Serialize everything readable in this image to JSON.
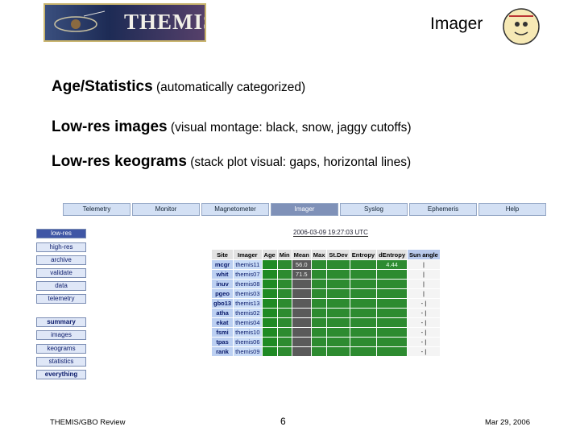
{
  "header": {
    "logo_text": "THEMIS",
    "title": "Imager"
  },
  "bullets": [
    {
      "bold": "Age/Statistics",
      "rest": " (automatically categorized)"
    },
    {
      "bold": "Low-res images",
      "rest": " (visual montage: black, snow, jaggy cutoffs)"
    },
    {
      "bold": "Low-res keograms",
      "rest": " (stack plot visual: gaps, horizontal lines)"
    }
  ],
  "nav": {
    "tabs": [
      "Telemetry",
      "Monitor",
      "Magnetometer",
      "Imager",
      "Syslog",
      "Ephemeris",
      "Help"
    ],
    "active": "Imager"
  },
  "sidebar": [
    "low-res",
    "high-res",
    "archive",
    "validate",
    "data",
    "telemetry",
    "summary",
    "images",
    "keograms",
    "statistics",
    "everything"
  ],
  "datetime": "2006-03-09 19:27:03 UTC",
  "table": {
    "headers": [
      "Site",
      "Imager",
      "Age",
      "Min",
      "Mean",
      "Max",
      "St.Dev",
      "Entropy",
      "dEntropy",
      "Sun angle"
    ],
    "rows": [
      {
        "site": "mcgr",
        "imager": "themis11",
        "min": "",
        "mean": "56.0",
        "max": "",
        "stdev": "",
        "entropy": "",
        "dentropy": "4.44",
        "sun": "|"
      },
      {
        "site": "whit",
        "imager": "themis07",
        "min": "",
        "mean": "71.5",
        "max": "",
        "stdev": "",
        "entropy": "",
        "dentropy": "",
        "sun": "|"
      },
      {
        "site": "inuv",
        "imager": "themis08",
        "min": "",
        "mean": "",
        "max": "",
        "stdev": "",
        "entropy": "",
        "dentropy": "",
        "sun": "|"
      },
      {
        "site": "pgeo",
        "imager": "themis03",
        "min": "",
        "mean": "",
        "max": "",
        "stdev": "",
        "entropy": "",
        "dentropy": "",
        "sun": "|"
      },
      {
        "site": "gbo13",
        "imager": "themis13",
        "min": "",
        "mean": "",
        "max": "",
        "stdev": "",
        "entropy": "",
        "dentropy": "",
        "sun": "- |"
      },
      {
        "site": "atha",
        "imager": "themis02",
        "min": "",
        "mean": "",
        "max": "",
        "stdev": "",
        "entropy": "",
        "dentropy": "",
        "sun": "- |"
      },
      {
        "site": "ekat",
        "imager": "themis04",
        "min": "",
        "mean": "",
        "max": "",
        "stdev": "",
        "entropy": "",
        "dentropy": "",
        "sun": "- |"
      },
      {
        "site": "fsmi",
        "imager": "themis10",
        "min": "",
        "mean": "",
        "max": "",
        "stdev": "",
        "entropy": "",
        "dentropy": "",
        "sun": "- |"
      },
      {
        "site": "tpas",
        "imager": "themis06",
        "min": "",
        "mean": "",
        "max": "",
        "stdev": "",
        "entropy": "",
        "dentropy": "",
        "sun": "- |"
      },
      {
        "site": "rank",
        "imager": "themis09",
        "min": "",
        "mean": "",
        "max": "",
        "stdev": "",
        "entropy": "",
        "dentropy": "",
        "sun": "- |"
      }
    ]
  },
  "footnote": "",
  "footer": {
    "left": "THEMIS/GBO Review",
    "center": "6",
    "right": "Mar 29, 2006"
  }
}
